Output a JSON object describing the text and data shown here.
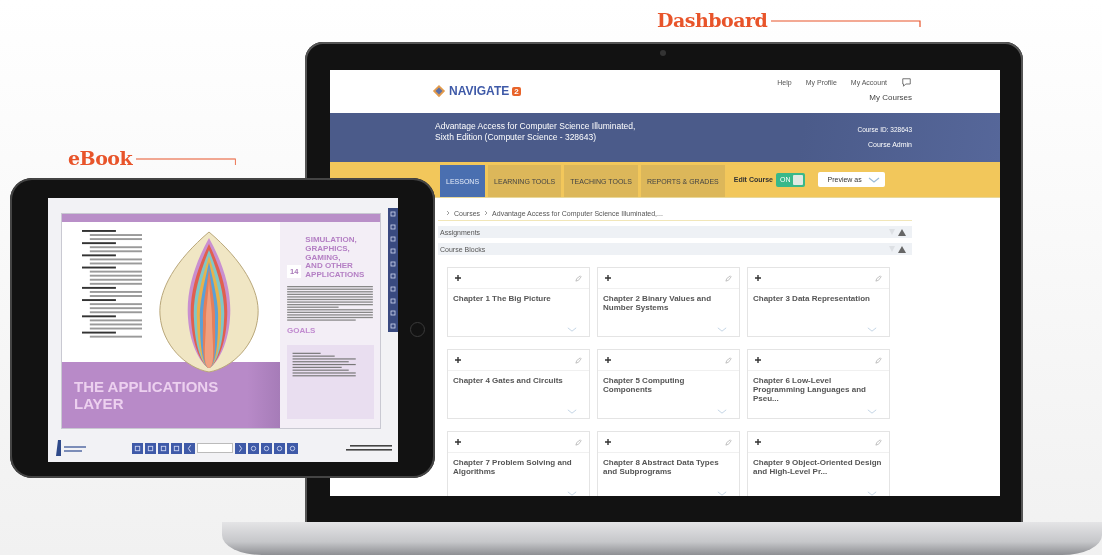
{
  "callouts": [
    {
      "kind": "dashboard",
      "text": "Dashboard"
    },
    {
      "kind": "ebook",
      "text": "eBook"
    }
  ],
  "dashboard": {
    "logo": {
      "name": "NAVIGATE",
      "badge": "2"
    },
    "top_links": [
      "Help",
      "My Profile",
      "My Account"
    ],
    "my_courses": "My Courses",
    "course": {
      "title_lines": [
        "Advantage Access for Computer Science Illuminated,",
        "Sixth Edition (Computer Science - 328643)"
      ],
      "course_id": "Course ID: 328643",
      "role": "Course Admin"
    },
    "tabs": [
      {
        "label": "LESSONS",
        "selected": true
      },
      {
        "label": "LEARNING TOOLS",
        "selected": false
      },
      {
        "label": "TEACHING TOOLS",
        "selected": false
      },
      {
        "label": "REPORTS & GRADES",
        "selected": false
      }
    ],
    "edit_course": {
      "label": "Edit Course",
      "on": true,
      "toggle_text": "ON"
    },
    "preview": {
      "label": "Preview as"
    },
    "breadcrumb": [
      "Courses",
      "Advantage Access for Computer Science Illuminated,..."
    ],
    "sections": [
      {
        "label": "Assignments"
      },
      {
        "label": "Course Blocks"
      }
    ],
    "cards": [
      {
        "title": "Chapter 1 The Big Picture"
      },
      {
        "title": "Chapter 2 Binary Values and Number Systems"
      },
      {
        "title": "Chapter 3 Data Representation"
      },
      {
        "title": "Chapter 4 Gates and Circuits"
      },
      {
        "title": "Chapter 5 Computing Components"
      },
      {
        "title": "Chapter 6 Low-Level Programming Languages and Pseu..."
      },
      {
        "title": "Chapter 7 Problem Solving and Algorithms"
      },
      {
        "title": "Chapter 8 Abstract Data Types and Subprograms"
      },
      {
        "title": "Chapter 9 Object-Oriented Design and High-Level Pr..."
      }
    ]
  },
  "ebook": {
    "chapter_number": "14",
    "chapter_title_lines": [
      "SIMULATION,",
      "GRAPHICS,",
      "GAMING,",
      "AND OTHER",
      "APPLICATIONS"
    ],
    "part_title_lines": [
      "THE APPLICATIONS",
      "LAYER"
    ],
    "goals_heading": "GOALS"
  }
}
